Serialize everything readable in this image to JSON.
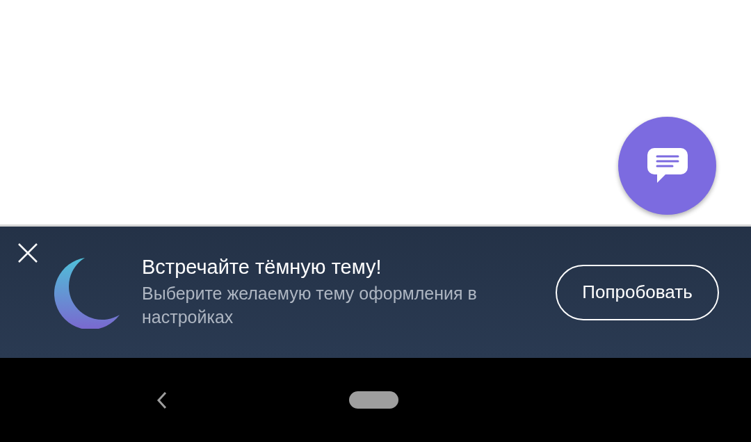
{
  "banner": {
    "title": "Встречайте тёмную тему!",
    "subtitle": "Выберите желаемую тему оформления в настройках",
    "button_label": "Попробовать"
  }
}
